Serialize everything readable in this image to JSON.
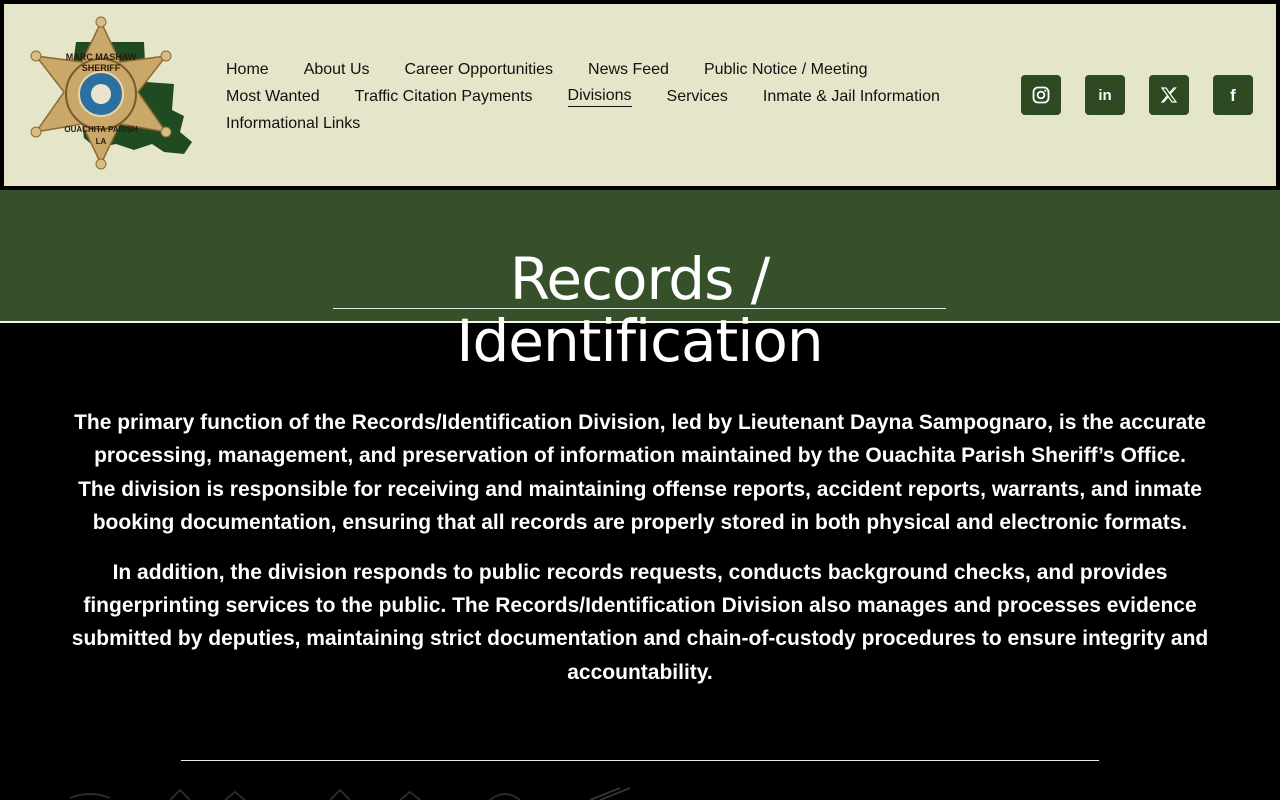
{
  "logo": {
    "text_top": "MARC MASHAW",
    "text_sheriff": "SHERIFF",
    "text_bottom": "OUACHITA PARISH",
    "text_state": "LA"
  },
  "nav": {
    "row1": [
      "Home",
      "About Us",
      "Career Opportunities",
      "News Feed",
      "Public Notice / Meeting"
    ],
    "row2": [
      "Most Wanted",
      "Traffic Citation Payments",
      "Divisions",
      "Services",
      "Inmate & Jail Information"
    ],
    "row3": [
      "Informational Links"
    ],
    "active": "Divisions"
  },
  "social": {
    "icons": [
      "instagram-icon",
      "linkedin-icon",
      "x-icon",
      "facebook-icon"
    ],
    "linkedin_text": "in",
    "facebook_text": "f"
  },
  "page": {
    "title": "Records / Identification"
  },
  "content": {
    "p1": "The primary function of the Records/Identification Division, led by Lieutenant Dayna Sampognaro, is the accurate processing, management, and preservation of information maintained by the Ouachita Parish Sheriff’s Office.",
    "p2": "The division is responsible for receiving and maintaining offense reports, accident reports, warrants, and inmate booking documentation, ensuring that all records are properly stored in both physical and electronic formats.",
    "p3": "In addition, the division responds to public records requests, conducts background checks, and provides fingerprinting services to the public. The Records/Identification Division also manages and processes evidence submitted by deputies, maintaining strict documentation and chain-of-custody procedures to ensure integrity and accountability."
  },
  "colors": {
    "header_bg": "#e5e5c9",
    "brand_green": "#36502a",
    "icon_bg": "#2e4a22",
    "body_bg": "#000000"
  }
}
